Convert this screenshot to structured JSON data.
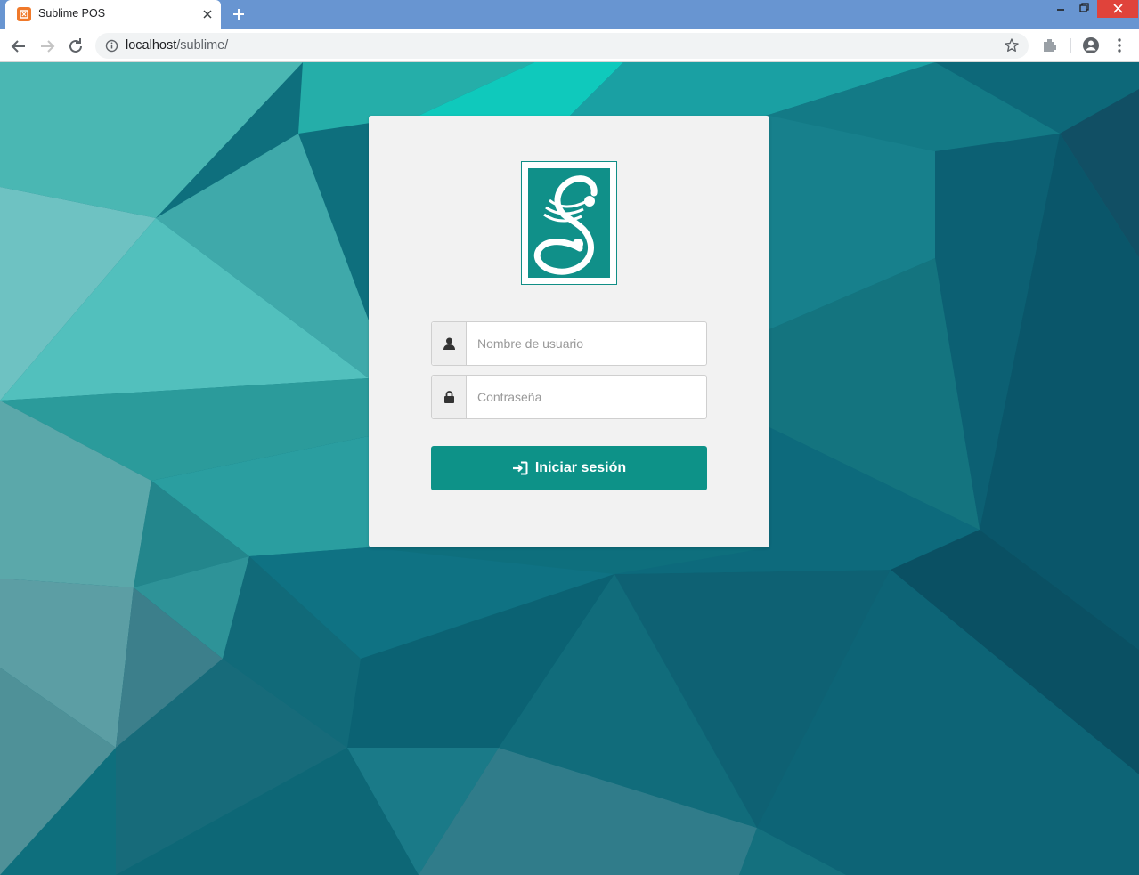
{
  "browser": {
    "tab_title": "Sublime POS",
    "url_host": "localhost",
    "url_path": "/sublime/"
  },
  "login": {
    "username_placeholder": "Nombre de usuario",
    "password_placeholder": "Contraseña",
    "button_label": "Iniciar sesión"
  },
  "colors": {
    "accent": "#0d9288",
    "titlebar": "#6895d1",
    "panel": "#f2f2f2"
  },
  "icons": {
    "username": "user-icon",
    "password": "lock-icon",
    "button": "sign-in-icon"
  }
}
